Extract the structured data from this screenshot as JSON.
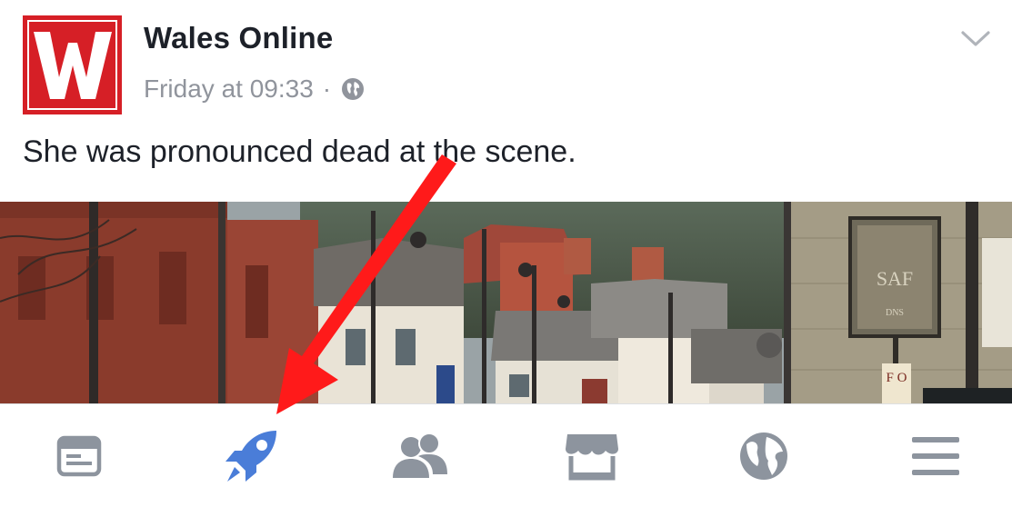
{
  "post": {
    "page_name": "Wales Online",
    "timestamp": "Friday at 09:33",
    "separator": "·",
    "privacy_icon": "globe-icon",
    "options_icon": "chevron-down-icon",
    "text": "She was pronounced dead at the scene.",
    "avatar": {
      "letter": "W",
      "bg_color": "#d61f26"
    },
    "photo": {
      "sign_text": "SAF",
      "sign_text_2": "DNS",
      "fo_sign": "F O"
    }
  },
  "annotation": {
    "icon": "red-arrow-icon",
    "color": "#ff1a1a"
  },
  "bottom_nav": {
    "active_color": "#4a7dd8",
    "inactive_color": "#8d949e",
    "items": [
      {
        "icon": "news-feed-icon",
        "active": false
      },
      {
        "icon": "rocket-icon",
        "active": true
      },
      {
        "icon": "friends-icon",
        "active": false
      },
      {
        "icon": "marketplace-icon",
        "active": false
      },
      {
        "icon": "notifications-globe-icon",
        "active": false
      },
      {
        "icon": "menu-icon",
        "active": false
      }
    ]
  }
}
